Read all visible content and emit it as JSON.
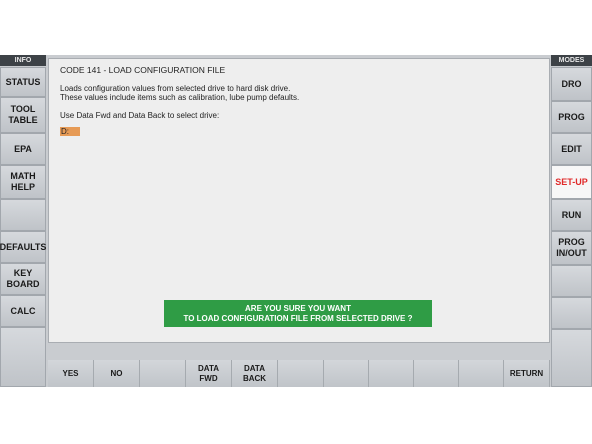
{
  "left_panel": {
    "title": "INFO",
    "buttons": [
      "STATUS",
      "TOOL\nTABLE",
      "EPA",
      "MATH\nHELP",
      "",
      "DEFAULTS",
      "KEY\nBOARD",
      "CALC",
      ""
    ]
  },
  "right_panel": {
    "title": "MODES",
    "buttons": [
      "DRO",
      "PROG",
      "EDIT",
      "SET-UP",
      "RUN",
      "PROG\nIN/OUT",
      "",
      "",
      ""
    ],
    "active": "SET-UP",
    "active_color": "#e02a2a"
  },
  "main": {
    "title": "CODE 141 - LOAD CONFIGURATION FILE",
    "desc_line1": "Loads configuration values from selected drive to hard disk drive.",
    "desc_line2": "These values include items such as calibration, lube pump defaults.",
    "instruction": "Use Data Fwd and Data Back to select drive:",
    "drive_value": "D:",
    "drive_highlight": "#e69a55"
  },
  "confirm": {
    "line1": "ARE YOU SURE YOU WANT",
    "line2": "TO LOAD CONFIGURATION FILE FROM SELECTED DRIVE ?",
    "color": "#2f9c45"
  },
  "function_keys": [
    "YES",
    "NO",
    "",
    "DATA\nFWD",
    "DATA\nBACK",
    "",
    "",
    "",
    "",
    "",
    "RETURN"
  ]
}
